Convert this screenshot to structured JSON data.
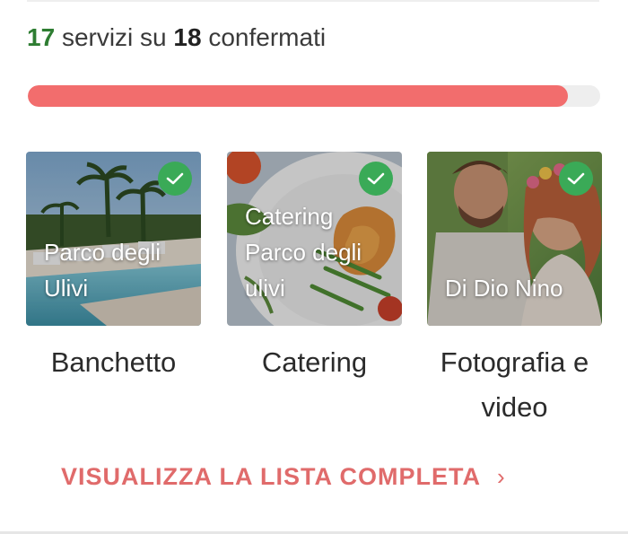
{
  "summary": {
    "confirmed_count": "17",
    "text_middle": "servizi su",
    "total_count": "18",
    "text_end": "confermati",
    "progress_fraction": 0.944
  },
  "colors": {
    "progress_fill": "#f26d6d",
    "progress_track": "#eeeeee",
    "check_badge": "#3aaa57",
    "confirmed_number": "#2e7d32",
    "cta_text": "#e06b6b"
  },
  "cards": [
    {
      "vendor": "Parco degli Ulivi",
      "category": "Banchetto",
      "icon": "check-icon"
    },
    {
      "vendor": "Catering Parco degli ulivi",
      "category": "Catering",
      "icon": "check-icon"
    },
    {
      "vendor": "Di Dio Nino",
      "category": "Fotografia e video",
      "icon": "check-icon"
    }
  ],
  "cta": {
    "label": "VISUALIZZA LA LISTA COMPLETA",
    "icon": "chevron-right-icon"
  }
}
